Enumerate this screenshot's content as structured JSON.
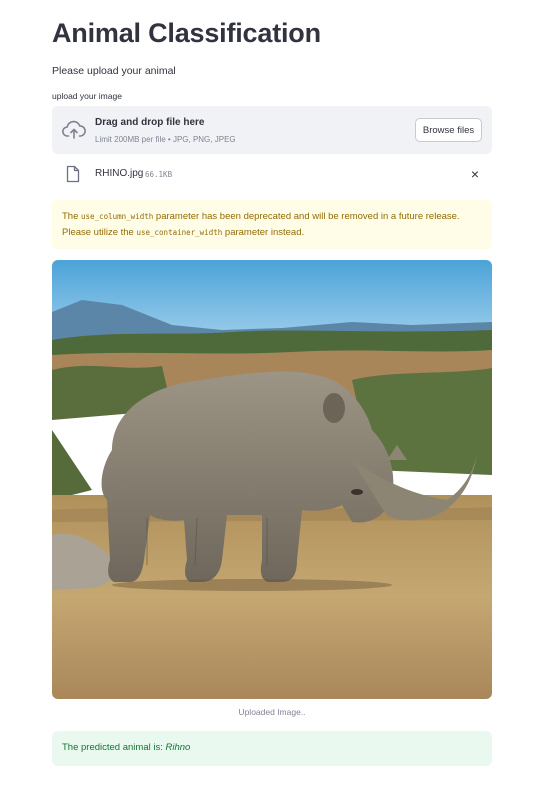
{
  "page": {
    "title": "Animal Classification",
    "subtitle": "Please upload your animal"
  },
  "uploader": {
    "label": "upload your image",
    "drop_title": "Drag and drop file here",
    "limit_text": "Limit 200MB per file • JPG, PNG, JPEG",
    "browse_label": "Browse files",
    "icon": "cloud-upload-icon"
  },
  "file": {
    "name": "RHINO.jpg",
    "size": "66.1KB",
    "icon": "file-icon",
    "remove_icon": "close-icon",
    "remove_glyph": "×"
  },
  "warning": {
    "part1": "The ",
    "code1": "use_column_width",
    "part2": " parameter has been deprecated and will be removed in a future release. Please utilize the ",
    "code2": "use_container_width",
    "part3": " parameter instead."
  },
  "image": {
    "caption": "Uploaded Image.."
  },
  "result": {
    "prefix": "The predicted animal is: ",
    "animal": "Rihno"
  },
  "colors": {
    "warning_bg": "#fffce7",
    "warning_text": "#926c05",
    "success_bg": "#e9f9ef",
    "success_text": "#177233",
    "dropzone_bg": "#f0f2f6"
  }
}
